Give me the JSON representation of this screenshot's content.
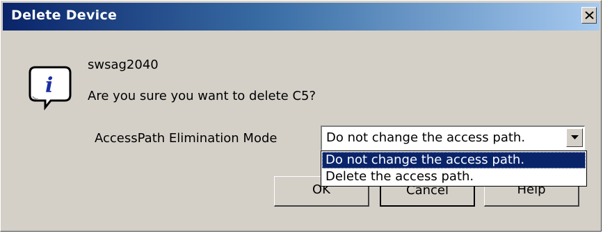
{
  "window": {
    "title": "Delete Device",
    "close_label": "×"
  },
  "message": {
    "icon": "info-icon",
    "device_name": "swsag2040",
    "question": "Are you sure you want to delete C5?"
  },
  "mode": {
    "label": "AccessPath Elimination Mode",
    "selected": "Do not change the access path.",
    "options": [
      "Do not change the access path.",
      "Delete the access path."
    ],
    "highlight_color": "#0a246a"
  },
  "buttons": {
    "ok": "OK",
    "cancel": "Cancel",
    "help": "Help"
  }
}
